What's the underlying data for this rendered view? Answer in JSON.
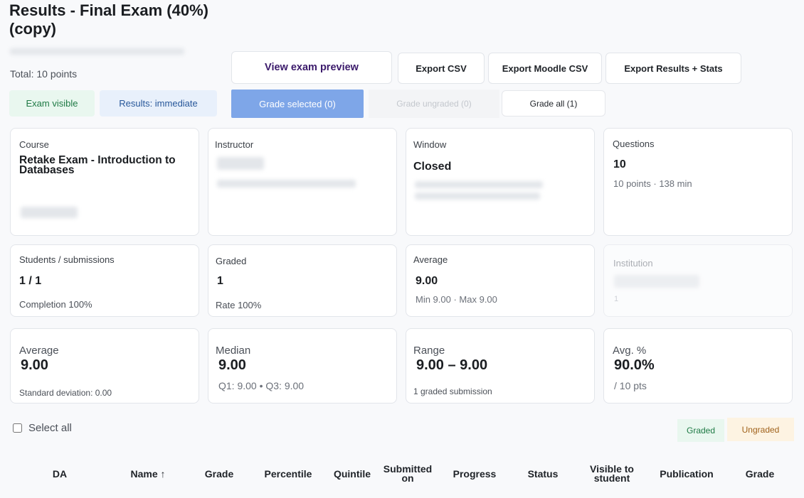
{
  "header": {
    "title": "Results - Final Exam (40%) (copy)",
    "total": "Total: 10 points"
  },
  "toolbar": {
    "preview": "View exam preview",
    "export_csv": "Export CSV",
    "export_moodle": "Export Moodle CSV",
    "export_stats": "Export Results + Stats",
    "grade_selected": "Grade selected (0)",
    "grade_ungraded": "Grade ungraded (0)",
    "grade_all": "Grade all (1)"
  },
  "badges": {
    "visible": "Exam visible",
    "results": "Results: immediate"
  },
  "info_cards": {
    "course": {
      "label": "Course",
      "value": "Retake Exam - Introduction to Databases"
    },
    "instructor": {
      "label": "Instructor"
    },
    "window": {
      "label": "Window",
      "value": "Closed"
    },
    "questions": {
      "label": "Questions",
      "value": "10",
      "sub": "10 points · 138 min"
    },
    "students": {
      "label": "Students / submissions",
      "value": "1 / 1",
      "sub": "Completion 100%"
    },
    "graded": {
      "label": "Graded",
      "value": "1",
      "sub": "Rate 100%"
    },
    "average": {
      "label": "Average",
      "value": "9.00",
      "sub": "Min 9.00 · Max 9.00"
    },
    "institution": {
      "label": "Institution",
      "sub": "1"
    }
  },
  "stats": {
    "average": {
      "label": "Average",
      "value": "9.00",
      "sub": "Standard deviation: 0.00"
    },
    "median": {
      "label": "Median",
      "value": "9.00",
      "sub": "Q1: 9.00 • Q3: 9.00"
    },
    "range": {
      "label": "Range",
      "value": "9.00 – 9.00",
      "sub": "1 graded submission"
    },
    "avg_pct": {
      "label": "Avg. %",
      "value": "90.0%",
      "sub": "/ 10 pts"
    }
  },
  "list": {
    "select_all": "Select all",
    "legend_graded": "Graded",
    "legend_ungraded": "Ungraded"
  },
  "table": {
    "columns": {
      "da": "DA",
      "name": "Name ↑",
      "grade": "Grade",
      "percentile": "Percentile",
      "quintile": "Quintile",
      "submitted": "Submitted on",
      "progress": "Progress",
      "status": "Status",
      "visible": "Visible to student",
      "publication": "Publication",
      "grade2": "Grade"
    }
  }
}
